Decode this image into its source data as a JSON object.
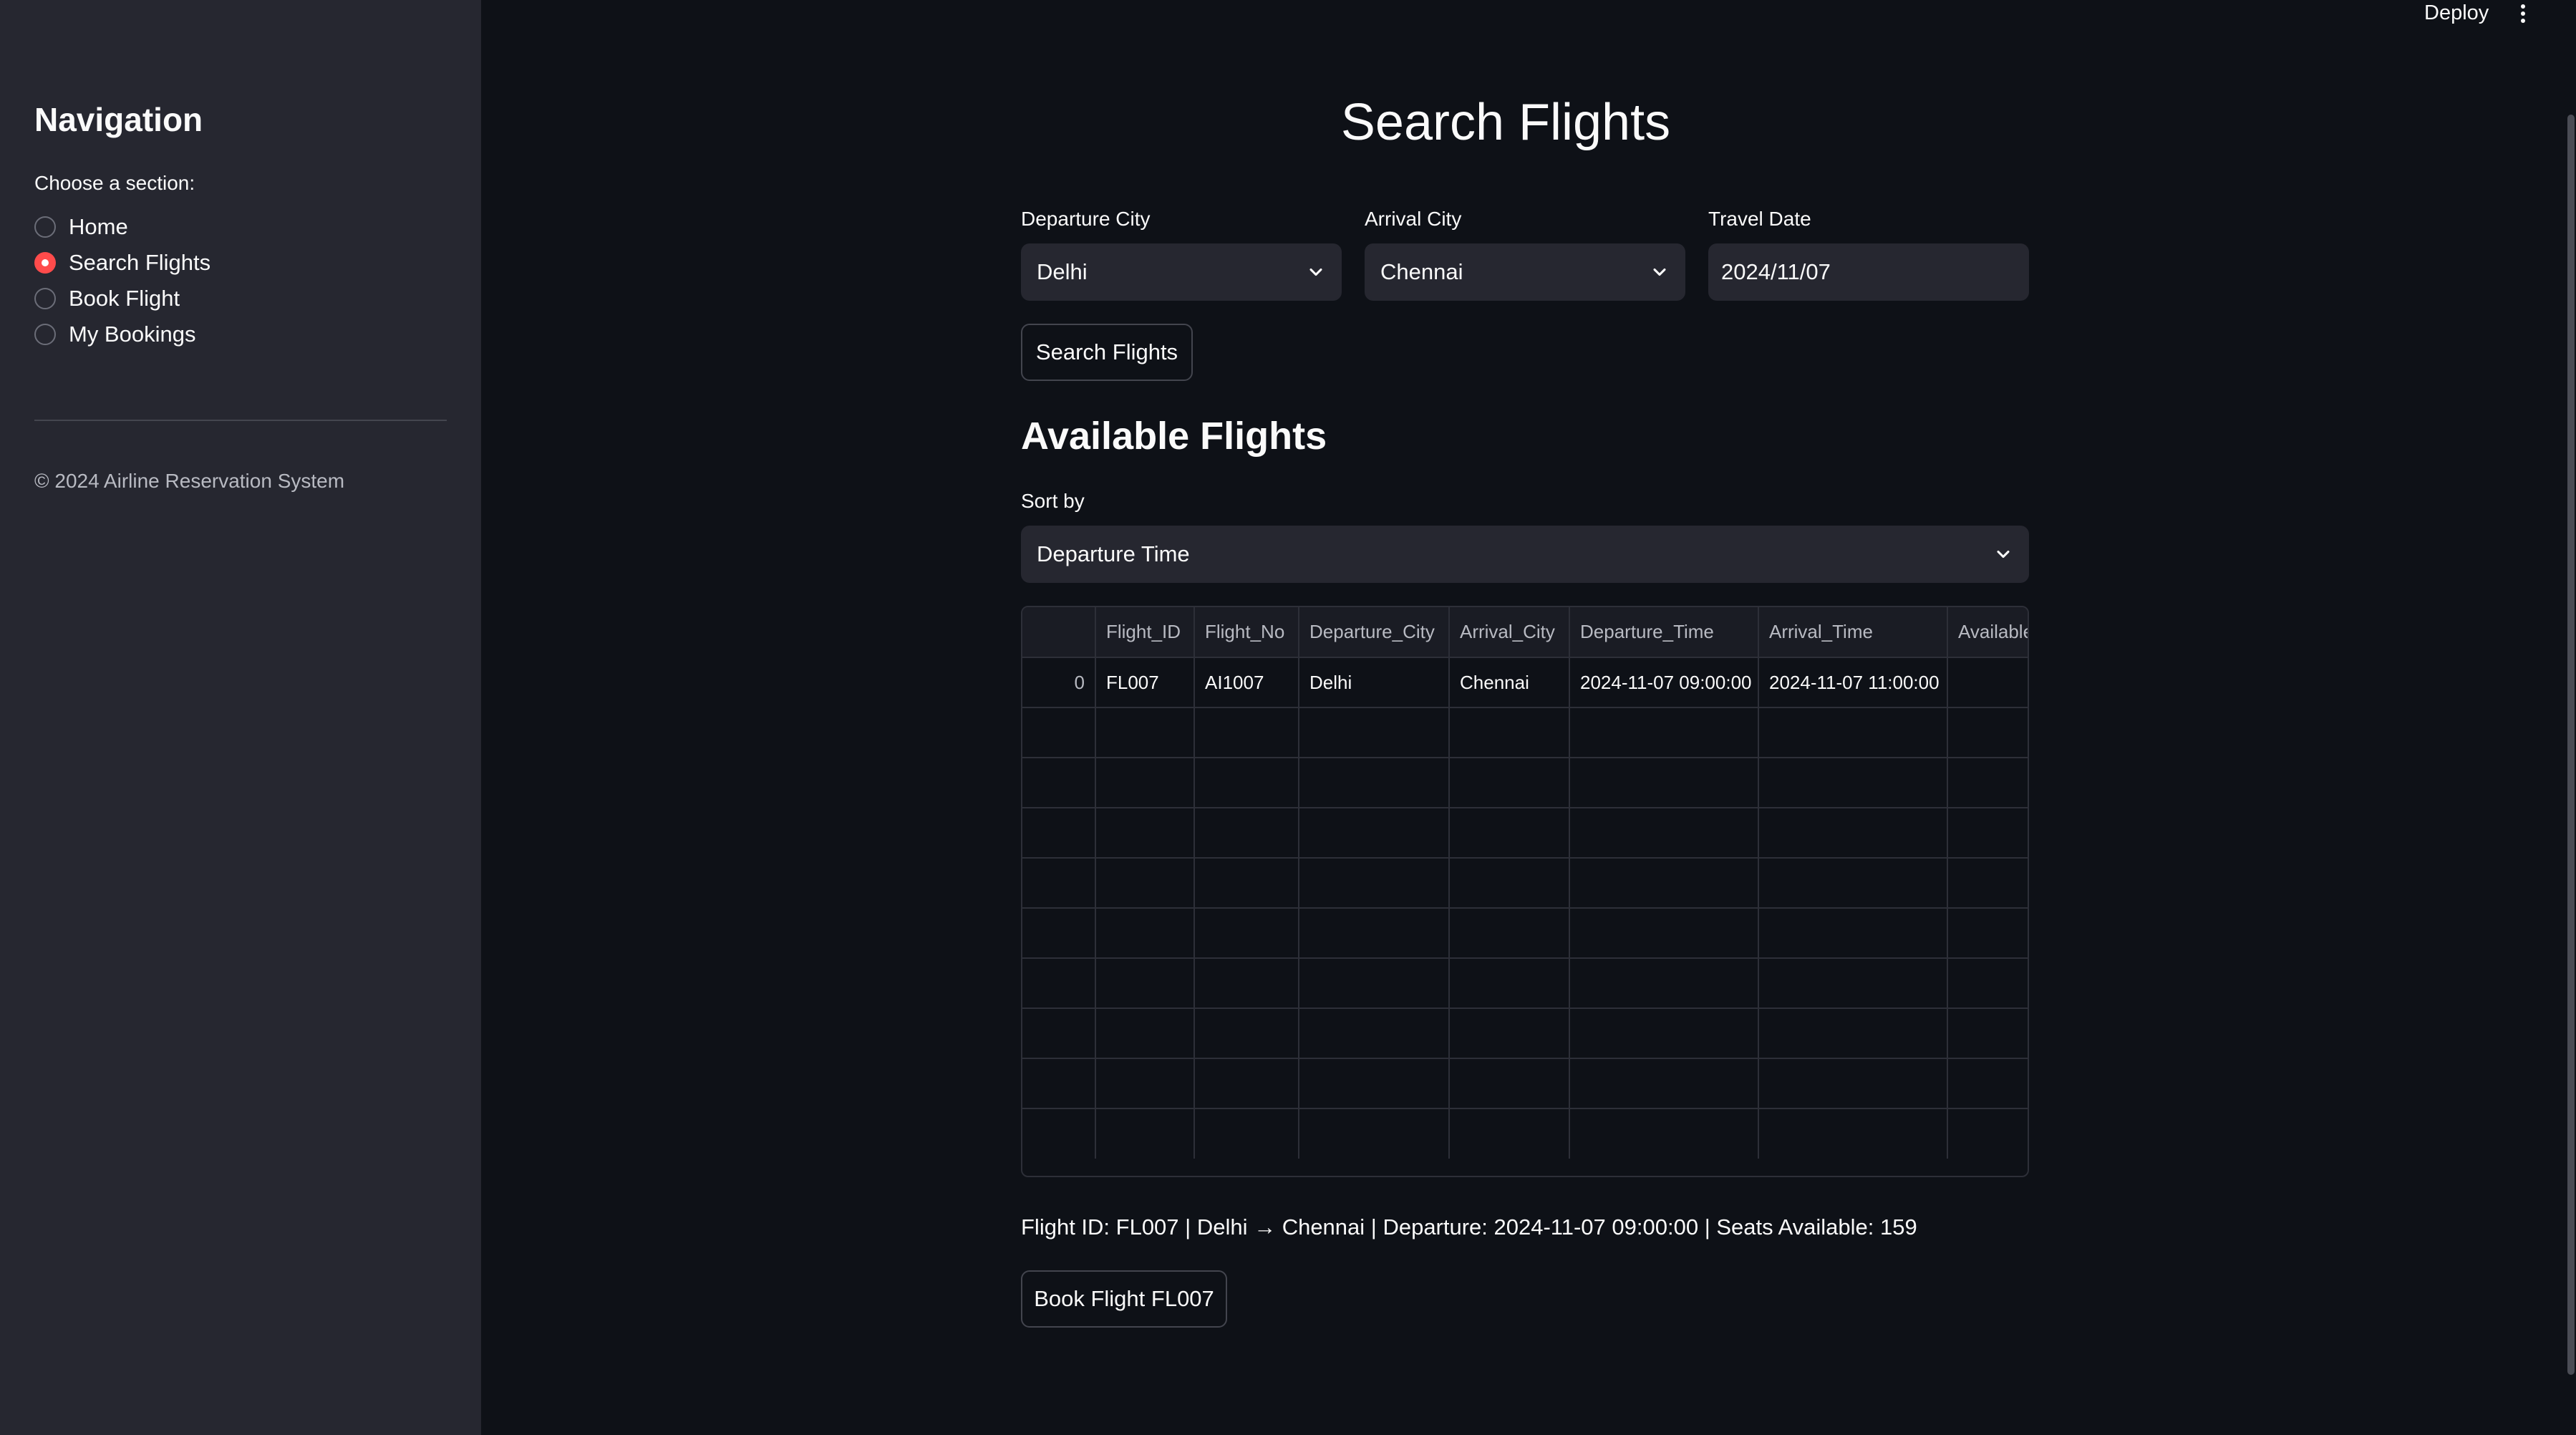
{
  "sidebar": {
    "title": "Navigation",
    "radio_label": "Choose a section:",
    "items": [
      {
        "label": "Home",
        "checked": false
      },
      {
        "label": "Search Flights",
        "checked": true
      },
      {
        "label": "Book Flight",
        "checked": false
      },
      {
        "label": "My Bookings",
        "checked": false
      }
    ],
    "footer": "© 2024 Airline Reservation System"
  },
  "header": {
    "deploy_label": "Deploy",
    "menu_icon": "kebab-menu-icon"
  },
  "main": {
    "title": "Search Flights",
    "departure": {
      "label": "Departure City",
      "value": "Delhi"
    },
    "arrival": {
      "label": "Arrival City",
      "value": "Chennai"
    },
    "date": {
      "label": "Travel Date",
      "value": "2024/11/07"
    },
    "search_button": "Search Flights",
    "available_heading": "Available Flights",
    "sort": {
      "label": "Sort by",
      "value": "Departure Time"
    },
    "table": {
      "columns": [
        "",
        "Flight_ID",
        "Flight_No",
        "Departure_City",
        "Arrival_City",
        "Departure_Time",
        "Arrival_Time",
        "Available"
      ],
      "rows": [
        [
          "0",
          "FL007",
          "AI1007",
          "Delhi",
          "Chennai",
          "2024-11-07 09:00:00",
          "2024-11-07 11:00:00",
          ""
        ]
      ],
      "empty_rows": 9
    },
    "flight_info": "Flight ID: FL007 | Delhi → Chennai | Departure: 2024-11-07 09:00:00 | Seats Available: 159",
    "book_button": "Book Flight FL007"
  },
  "colors": {
    "accent": "#ff4b4b",
    "background": "#0e1117",
    "sidebar": "#262730"
  }
}
